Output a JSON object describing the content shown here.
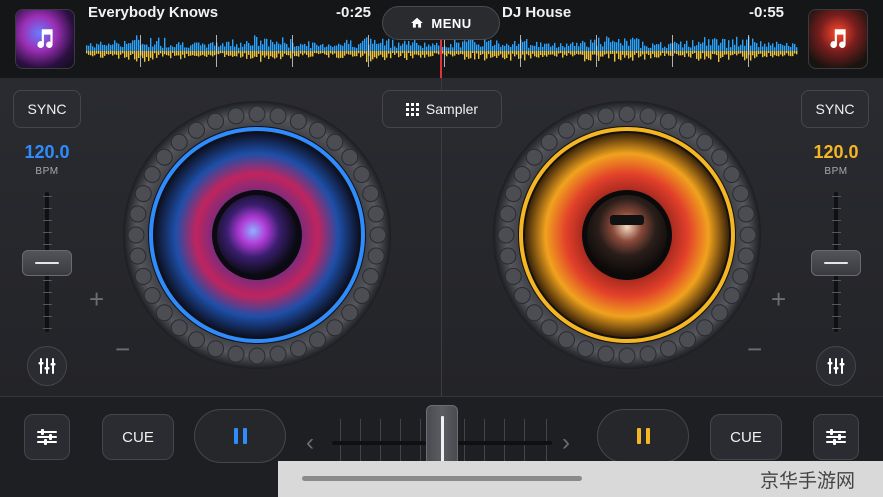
{
  "left_deck": {
    "track_title": "Everybody Knows",
    "remaining_time": "-0:25",
    "sync_label": "SYNC",
    "bpm_value": "120.0",
    "bpm_label": "BPM",
    "pitch_level": 0.5,
    "accent_color": "#2f8cff",
    "cue_label": "CUE",
    "cover_icon": "music-note-icon"
  },
  "right_deck": {
    "track_title": "DJ House",
    "remaining_time": "-0:55",
    "sync_label": "SYNC",
    "bpm_value": "120.0",
    "bpm_label": "BPM",
    "pitch_level": 0.5,
    "accent_color": "#f5b623",
    "cue_label": "CUE",
    "cover_icon": "music-note-icon"
  },
  "header": {
    "menu_label": "MENU",
    "menu_icon": "home-icon"
  },
  "center": {
    "sampler_label": "Sampler",
    "sampler_icon": "grid-icon",
    "crossfader_position": 0.5
  },
  "plus_label": "+",
  "minus_label": "−",
  "watermark_text": "京华手游网",
  "colors": {
    "playhead": "#e0323c",
    "waveform_blue": "#2aa3ff",
    "waveform_yellow": "#f0c43a"
  }
}
